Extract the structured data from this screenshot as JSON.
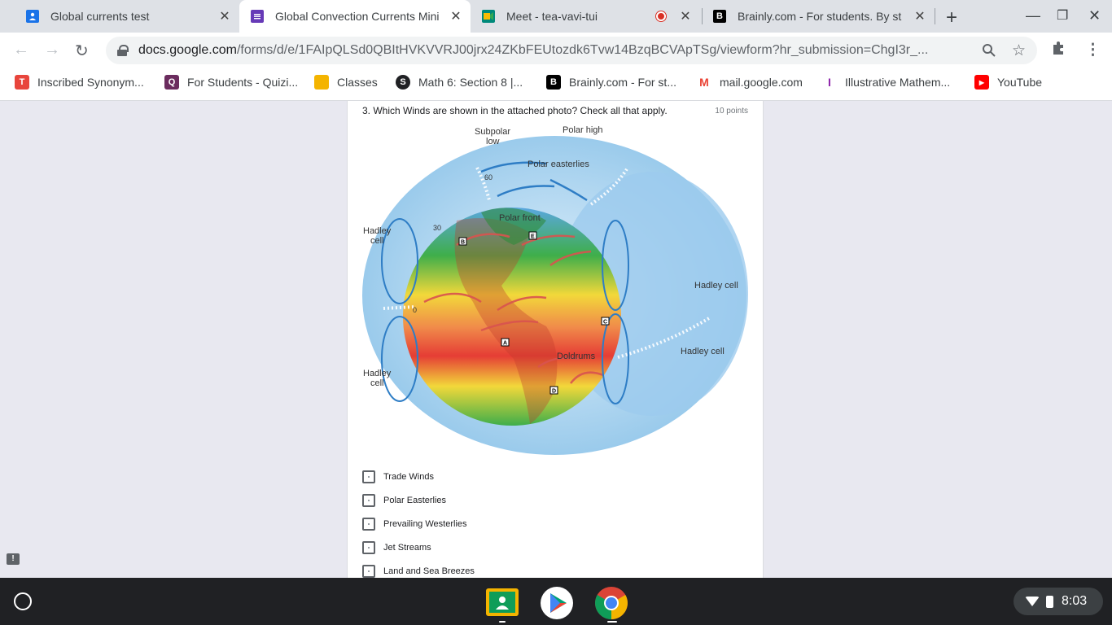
{
  "tabs": [
    {
      "title": "Global currents test",
      "icon": "classroom-icon"
    },
    {
      "title": "Global Convection Currents Mini",
      "icon": "forms-icon"
    },
    {
      "title": "Meet - tea-vavi-tui",
      "icon": "meet-icon"
    },
    {
      "title": "Brainly.com - For students. By st",
      "icon": "brainly-icon"
    }
  ],
  "toolbar": {
    "url_host": "docs.google.com",
    "url_path": "/forms/d/e/1FAIpQLSd0QBItHVKVVRJ00jrx24ZKbFEUtozdk6Tvw14BzqBCVApTSg/viewform?hr_submission=ChgI3r_..."
  },
  "bookmarks": [
    {
      "label": "Inscribed Synonym...",
      "color": "#e8453c",
      "glyph": "T"
    },
    {
      "label": "For Students - Quizi...",
      "color": "#6b2c5e",
      "glyph": "Q"
    },
    {
      "label": "Classes",
      "color": "#f4b400",
      "glyph": ""
    },
    {
      "label": "Math 6: Section 8 |...",
      "color": "#202124",
      "glyph": "S"
    },
    {
      "label": "Brainly.com - For st...",
      "color": "#000000",
      "glyph": "B"
    },
    {
      "label": "mail.google.com",
      "color": "#ea4335",
      "glyph": "M"
    },
    {
      "label": "Illustrative Mathem...",
      "color": "#8e24aa",
      "glyph": "I"
    },
    {
      "label": "YouTube",
      "color": "#ff0000",
      "glyph": "▶"
    }
  ],
  "question": {
    "title": "3. Which Winds are shown in the attached photo? Check all that apply.",
    "points": "10 points"
  },
  "figure_labels": {
    "subpolar_low": [
      "Subpolar",
      "low"
    ],
    "polar_high": "Polar high",
    "polar_easterlies": "Polar easterlies",
    "polar_front": "Polar front",
    "hadley_cell_left_top": [
      "Hadley",
      "cell"
    ],
    "hadley_cell_left_bottom": [
      "Hadley",
      "cell"
    ],
    "hadley_cell_right_top": "Hadley cell",
    "hadley_cell_right_bottom": "Hadley cell",
    "doldrums": "Doldrums",
    "lat_60": "60",
    "lat_30": "30",
    "lat_0": "0",
    "marker_a": "A",
    "marker_b": "B",
    "marker_c": "C",
    "marker_d": "D",
    "marker_e": "E"
  },
  "options": [
    "Trade Winds",
    "Polar Easterlies",
    "Prevailing Westerlies",
    "Jet Streams",
    "Land and Sea Breezes"
  ],
  "shelf": {
    "time": "8:03"
  }
}
